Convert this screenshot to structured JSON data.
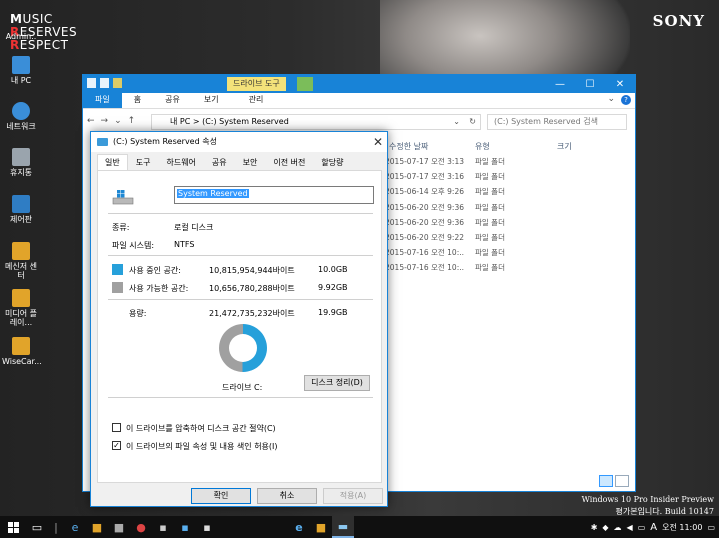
{
  "wallpaper": {
    "music_lines": [
      "USIC",
      "ESERVES",
      "ESPECT"
    ],
    "music_initials": [
      "M",
      "R",
      "R"
    ],
    "brand": "SONY"
  },
  "desktop_icons": [
    {
      "label": "Admin..",
      "color": "#e1a42a",
      "icon": "user-folder-icon"
    },
    {
      "label": "내 PC",
      "color": "#3a8ed8",
      "icon": "computer-icon"
    },
    {
      "label": "네트워크",
      "color": "#3a8ed8",
      "icon": "network-icon"
    },
    {
      "label": "휴지통",
      "color": "#9aa4ad",
      "icon": "recycle-bin-icon"
    },
    {
      "label": "제어판",
      "color": "#2f7dc4",
      "icon": "control-panel-icon"
    },
    {
      "label": "메신저 센터",
      "color": "#e1a42a",
      "icon": "folder-icon"
    },
    {
      "label": "미디어 플레이...",
      "color": "#e1a42a",
      "icon": "folder-icon"
    },
    {
      "label": "WiseCar...",
      "color": "#e1a42a",
      "icon": "folder-icon"
    }
  ],
  "watermark": {
    "line1": "Windows 10 Pro Insider Preview",
    "line2": "평가본입니다. Build 10147"
  },
  "explorer": {
    "context_tab": "드라이브 도구",
    "ribbon_tabs": [
      "파일",
      "홈",
      "공유",
      "보기",
      "관리"
    ],
    "address": "내 PC  >  (C:) System Reserved",
    "search_placeholder": "(C:) System Reserved 검색",
    "columns": {
      "date": "수정한 날짜",
      "type": "유형",
      "size": "크기"
    },
    "rows": [
      {
        "date": "2015-07-17 오전 3:13",
        "type": "파일 폴더"
      },
      {
        "date": "2015-07-17 오전 3:16",
        "type": "파일 폴더"
      },
      {
        "date": "2015-06-14 오후 9:26",
        "type": "파일 폴더"
      },
      {
        "date": "2015-06-20 오전 9:36",
        "type": "파일 폴더"
      },
      {
        "date": "2015-06-20 오전 9:36",
        "type": "파일 폴더"
      },
      {
        "date": "2015-06-20 오전 9:22",
        "type": "파일 폴더"
      },
      {
        "date": "2015-07-16 오전 10:..",
        "type": "파일 폴더"
      },
      {
        "date": "2015-07-16 오전 10:..",
        "type": "파일 폴더"
      }
    ]
  },
  "properties": {
    "title": "(C:) System Reserved 속성",
    "tabs": [
      "일반",
      "도구",
      "하드웨어",
      "공유",
      "보안",
      "이전 버전",
      "할당량"
    ],
    "volume_name": "System Reserved",
    "type_label": "종류:",
    "type_value": "로컬 디스크",
    "fs_label": "파일 시스템:",
    "fs_value": "NTFS",
    "used_label": "사용 중인 공간:",
    "used_bytes": "10,815,954,944바이트",
    "used_gb": "10.0GB",
    "free_label": "사용 가능한 공간:",
    "free_bytes": "10,656,780,288바이트",
    "free_gb": "9.92GB",
    "cap_label": "용량:",
    "cap_bytes": "21,472,735,232바이트",
    "cap_gb": "19.9GB",
    "used_fraction": 0.503,
    "used_color": "#26a0da",
    "free_color": "#a0a0a0",
    "drive_label": "드라이브 C:",
    "cleanup_btn": "디스크 정리(D)",
    "compress_label": "이 드라이브를 압축하여 디스크 공간 절약(C)",
    "compress_checked": false,
    "index_label": "이 드라이브의 파일 속성 및 내용 색인 허용(I)",
    "index_checked": true,
    "ok": "확인",
    "cancel": "취소",
    "apply": "적용(A)"
  },
  "taskbar": {
    "clock": "오전 11:00",
    "ime": "A"
  }
}
